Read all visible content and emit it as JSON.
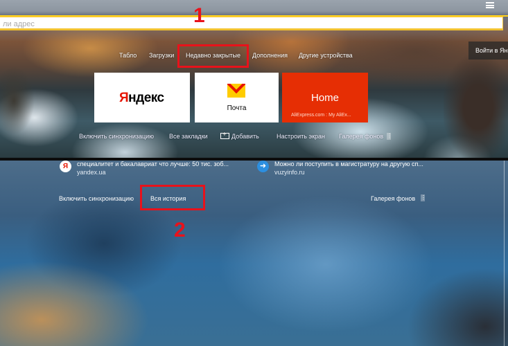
{
  "top": {
    "address_placeholder": "ли адрес",
    "nav": [
      "Табло",
      "Загрузки",
      "Недавно закрытые",
      "Дополнения",
      "Другие устройства"
    ],
    "login_label": "Войти в Ян",
    "tiles": {
      "yandex_first": "Я",
      "yandex_rest": "ндекс",
      "mail_label": "Почта",
      "home_title": "Home",
      "home_sub": "AliExpress.com : My AliEx..."
    },
    "bottom_links": {
      "sync": "Включить синхронизацию",
      "bookmarks": "Все закладки",
      "add": "Добавить",
      "customize": "Настроить экран",
      "gallery": "Галерея фонов",
      "more": "⋮"
    },
    "annotation_number": "1"
  },
  "bottom": {
    "recent": [
      {
        "icon": "Я",
        "title": "специалитет и бакалавриат что лучше: 50 тис. зоб...",
        "domain": "yandex.ua"
      },
      {
        "icon": "➜",
        "title": "Можно ли поступить в магистратуру на другую сп...",
        "domain": "vuzyinfo.ru"
      }
    ],
    "links": {
      "sync": "Включить синхронизацию",
      "history": "Вся история",
      "gallery": "Галерея фонов",
      "more": "⋮"
    },
    "annotation_number": "2"
  },
  "colors": {
    "annotation": "#e8121b",
    "accent_yellow": "#ffd21e",
    "home_tile": "#e62e04",
    "yandex_red": "#e61400"
  }
}
